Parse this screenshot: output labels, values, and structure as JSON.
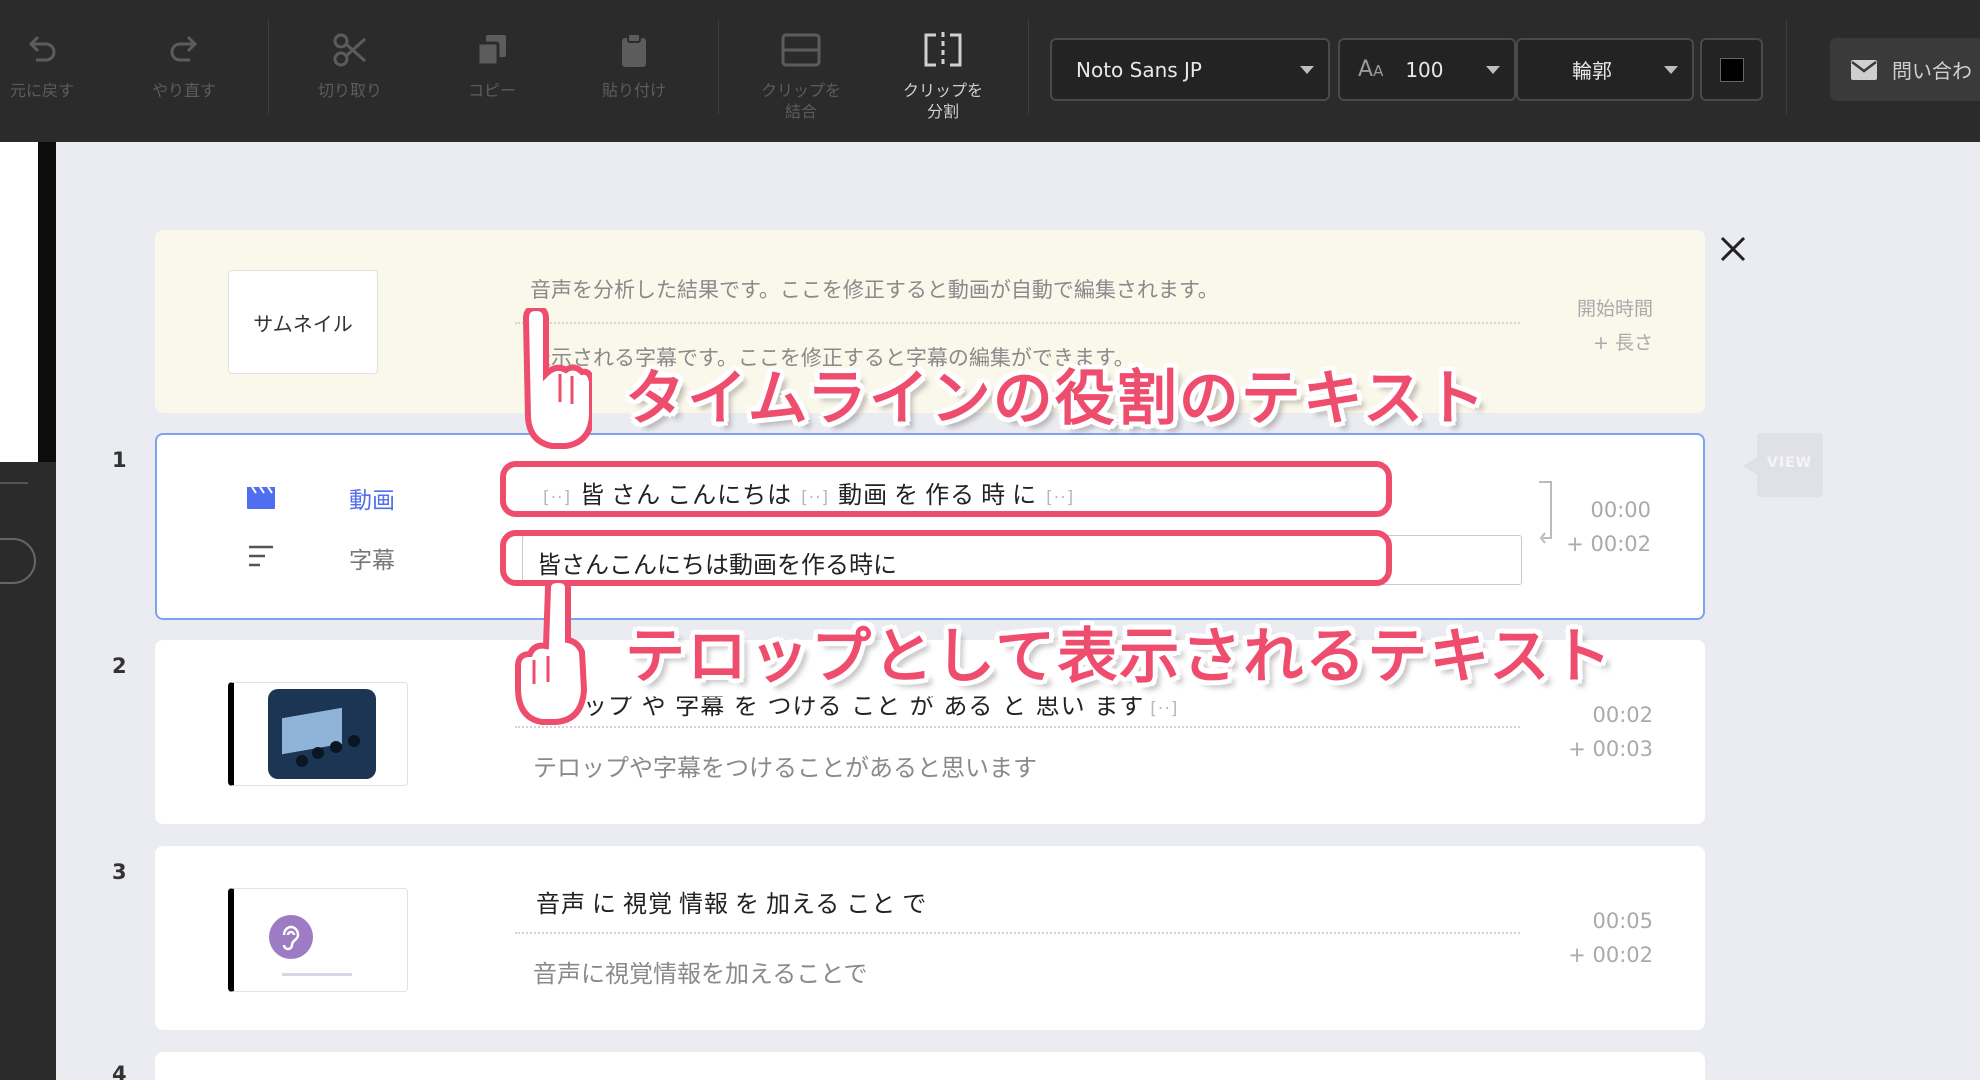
{
  "toolbar": {
    "undo": "元に戻す",
    "redo": "やり直す",
    "cut": "切り取り",
    "copy": "コピー",
    "paste": "貼り付け",
    "merge_clip": "クリップを\n結合",
    "split_clip": "クリップを\n分割",
    "font_family": "Noto Sans JP",
    "font_size": "100",
    "outline": "輪郭",
    "contact": "問い合わ"
  },
  "header_row": {
    "thumbnail_label": "サムネイル",
    "description": "音声を分析した結果です。ここを修正すると動画が自動で編集されます。",
    "second_line": "表示される字幕です。ここを修正すると字幕の編集ができます。",
    "start_time_label": "開始時間",
    "length_label": "+ 長さ"
  },
  "rows": [
    {
      "number": "1",
      "video_label": "動画",
      "subtitle_label": "字幕",
      "words": [
        "皆",
        "さん",
        "こんにちは",
        "動画",
        "を",
        "作る",
        "時",
        "に"
      ],
      "pause": "[··]",
      "subtitle": "皆さんこんにちは動画を作る時に",
      "start": "00:00",
      "length": "+ 00:02"
    },
    {
      "number": "2",
      "words_text": "テロップ や 字幕 を つける こと が ある と 思い ます",
      "pause": "[··]",
      "subtitle": "テロップや字幕をつけることがあると思います",
      "start": "00:02",
      "length": "+ 00:03"
    },
    {
      "number": "3",
      "words": [
        "音声",
        "に",
        "視覚",
        "情報",
        "を",
        "加える",
        "こと",
        "で"
      ],
      "subtitle": "音声に視覚情報を加えることで",
      "start": "00:05",
      "length": "+ 00:02"
    },
    {
      "number": "4"
    }
  ],
  "view_badge": "VIEW",
  "annotations": {
    "top": "タイムラインの役割のテキスト",
    "bottom": "テロップとして表示されるテキスト",
    "color": "#ee4d6e"
  },
  "colors": {
    "toolbar_bg": "#2b2b2b",
    "canvas_bg": "#ebecf1",
    "header_row_bg": "#faf7eb",
    "selected_border": "#7ba3f0",
    "accent_blue": "#4f6ff0"
  },
  "icons": {
    "undo": "undo-icon",
    "redo": "redo-icon",
    "cut": "scissors-icon",
    "copy": "copy-icon",
    "paste": "clipboard-icon",
    "merge": "merge-icon",
    "split": "split-icon",
    "font_size": "font-size-icon",
    "color": "color-swatch-icon",
    "mail": "mail-icon",
    "close": "close-icon",
    "video": "clapperboard-icon",
    "subtitle": "text-lines-icon",
    "pointer": "pointing-hand-icon"
  }
}
